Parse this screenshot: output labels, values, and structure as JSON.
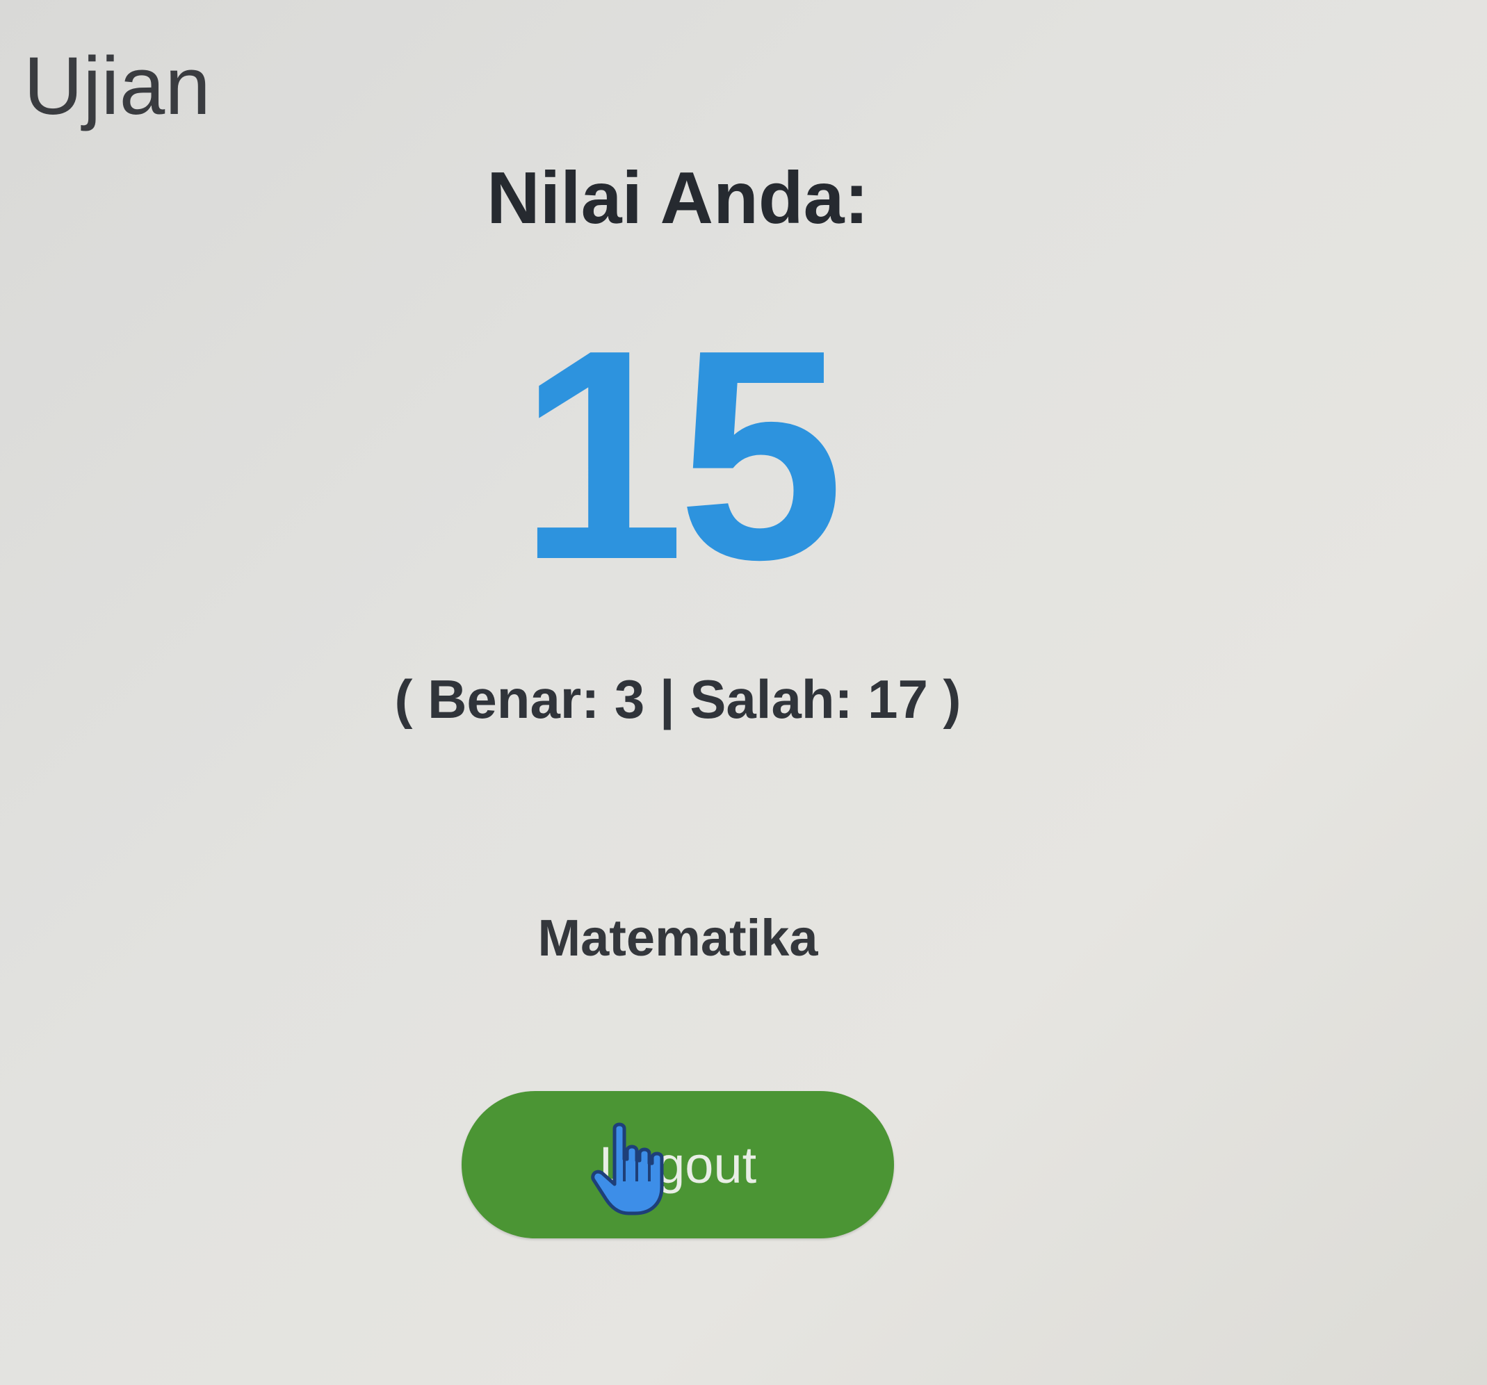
{
  "header": {
    "title": "Ujian"
  },
  "result": {
    "heading": "Nilai Anda:",
    "score": "15",
    "detail": "( Benar: 3 | Salah: 17 )",
    "subject": "Matematika"
  },
  "actions": {
    "logout_label": "Logout"
  },
  "colors": {
    "score": "#2d93de",
    "logout_button": "#4b9534",
    "background": "#e2e2df"
  },
  "icons": {
    "cursor": "hand-pointer-icon"
  }
}
